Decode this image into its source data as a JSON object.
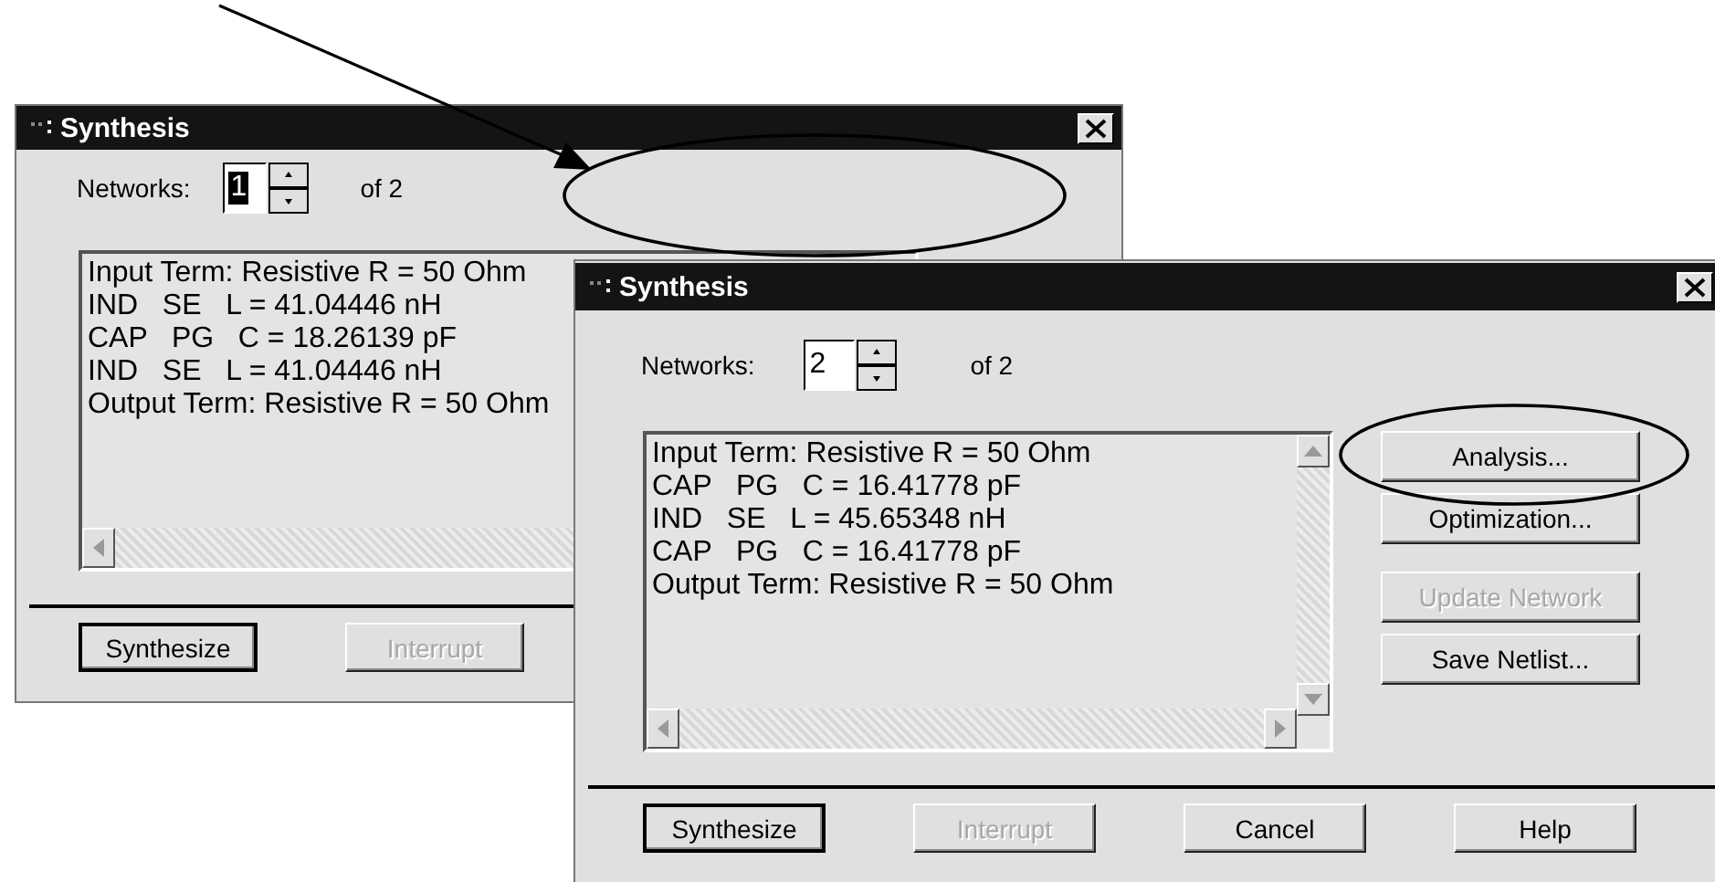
{
  "windows": [
    {
      "kind": "background",
      "title": "Synthesis",
      "networks_label": "Networks:",
      "network_value": "1",
      "value_highlighted": true,
      "count_text": "of 2",
      "list_lines": [
        "Input Term: Resistive R = 50 Ohm",
        "IND   SE   L = 41.04446 nH",
        "CAP   PG   C = 18.26139 pF",
        "IND   SE   L = 41.04446 nH",
        "Output Term: Resistive R = 50 Ohm"
      ],
      "buttons": [
        {
          "label": "Synthesize",
          "disabled": false,
          "default": true
        },
        {
          "label": "Interrupt",
          "disabled": true,
          "default": false
        }
      ]
    },
    {
      "kind": "foreground",
      "title": "Synthesis",
      "networks_label": "Networks:",
      "network_value": "2",
      "value_highlighted": false,
      "count_text": "of 2",
      "list_lines": [
        "Input Term: Resistive R = 50 Ohm",
        "CAP   PG   C = 16.41778 pF",
        "IND   SE   L = 45.65348 nH",
        "CAP   PG   C = 16.41778 pF",
        "Output Term: Resistive R = 50 Ohm"
      ],
      "side_buttons": [
        {
          "label": "Analysis...",
          "disabled": false
        },
        {
          "label": "Optimization...",
          "disabled": false
        },
        {
          "label": "Update Network",
          "disabled": true
        },
        {
          "label": "Save Netlist...",
          "disabled": false
        }
      ],
      "buttons": [
        {
          "label": "Synthesize",
          "disabled": false,
          "default": true
        },
        {
          "label": "Interrupt",
          "disabled": true,
          "default": false
        },
        {
          "label": "Cancel",
          "disabled": false,
          "default": false
        },
        {
          "label": "Help",
          "disabled": false,
          "default": false
        }
      ]
    }
  ]
}
